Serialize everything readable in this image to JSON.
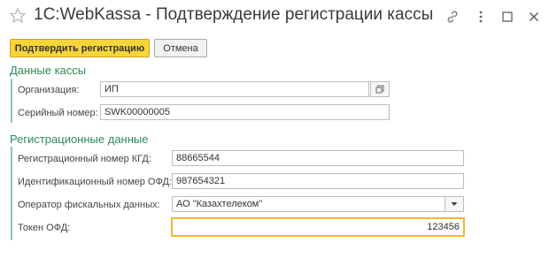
{
  "window": {
    "title": "1С:WebKassa - Подтверждение регистрации кассы"
  },
  "titlebar_icons": {
    "favorite": "star-icon",
    "link": "link-icon",
    "more": "more-vertical-icon",
    "maximize": "maximize-icon",
    "close": "close-icon"
  },
  "toolbar": {
    "confirm_label": "Подтвердить регистрацию",
    "cancel_label": "Отмена"
  },
  "sections": {
    "cash_register": {
      "title": "Данные кассы",
      "organization_label": "Организация:",
      "organization_value": "ИП",
      "serial_label": "Серийный номер:",
      "serial_value": "SWK00000005"
    },
    "registration": {
      "title": "Регистрационные данные",
      "kgd_label": "Регистрационный номер КГД:",
      "kgd_value": "88665544",
      "ofd_id_label": "Идентификационный номер ОФД:",
      "ofd_id_value": "987654321",
      "operator_label": "Оператор фискальных данных:",
      "operator_value": "АО \"Казахтелеком\"",
      "token_label": "Токен ОФД:",
      "token_value": "123456"
    }
  },
  "colors": {
    "primary_button": "#f7d53a",
    "section_title": "#2e8b57",
    "focus_border": "#f2b630"
  }
}
